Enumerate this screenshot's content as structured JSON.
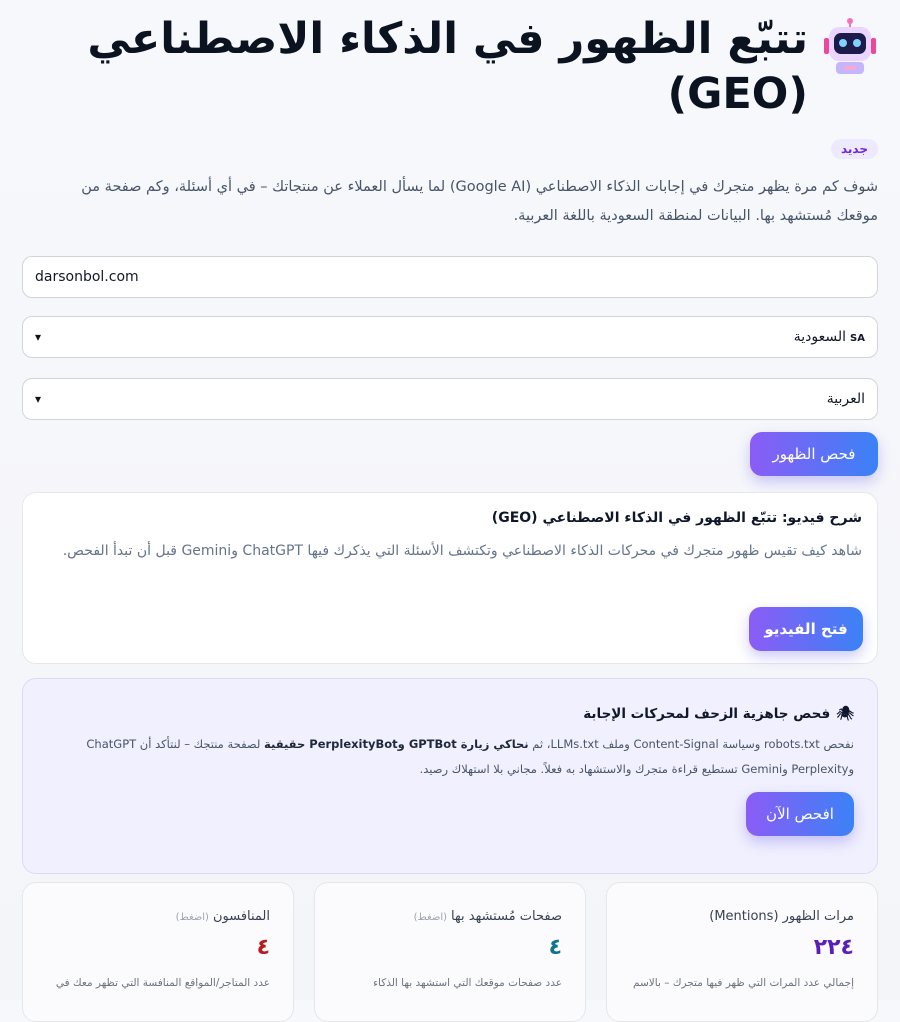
{
  "header": {
    "title": "تتبّع الظهور في الذكاء الاصطناعي (GEO)",
    "badge": "جديد",
    "intro": "شوف كم مرة يظهر متجرك في إجابات الذكاء الاصطناعي (Google AI) لما يسأل العملاء عن منتجاتك – في أي أسئلة، وكم صفحة من موقعك مُستشهد بها. البيانات لمنطقة السعودية باللغة العربية."
  },
  "form": {
    "domain_value": "darsonbol.com",
    "country_code": "SA",
    "country_value": "السعودية",
    "language_value": "العربية",
    "check_button": "فحص الظهور"
  },
  "video": {
    "title": "شرح فيديو: تتبّع الظهور في الذكاء الاصطناعي (GEO)",
    "description": "شاهد كيف تقيس ظهور متجرك في محركات الذكاء الاصطناعي وتكتشف الأسئلة التي يذكرك فيها ChatGPT وGemini قبل أن تبدأ الفحص.",
    "button": "فتح الفيديو"
  },
  "crawl": {
    "title": "فحص جاهزية الزحف لمحركات الإجابة",
    "desc_1": "نفحص robots.txt وسياسة Content-Signal وملف LLMs.txt، ثم ",
    "desc_bold_1": "نحاكي زيارة GPTBot وPerplexityBot حقيقية",
    "desc_2": " لصفحة منتجك – لنتأكد أن ChatGPT وPerplexity وGemini تستطيع قراءة متجرك والاستشهاد به فعلاً. مجاني بلا استهلاك رصيد.",
    "button": "افحص الآن"
  },
  "metrics": [
    {
      "label": "مرات الظهور (Mentions)",
      "hint": "",
      "value": "٢٢٤",
      "desc": "إجمالي عدد المرات التي ظهر فيها متجرك – بالاسم"
    },
    {
      "label": "صفحات مُستشهد بها",
      "hint": "(اضغط)",
      "value": "٤",
      "desc": "عدد صفحات موقعك التي استشهد بها الذكاء"
    },
    {
      "label": "المنافسون",
      "hint": "(اضغط)",
      "value": "٤",
      "desc": "عدد المتاجر/المواقع المنافسة التي تظهر معك في"
    }
  ],
  "colors": {
    "accent_start": "#8b5cf6",
    "accent_end": "#3b82f6",
    "mentions_value": "#5b21b6",
    "citations_value": "#0e7490",
    "competitors_value": "#b91c1c"
  },
  "icons": {
    "title_icon": "robot-icon",
    "crawl_icon": "spider-icon",
    "select_icon": "chevron-down-icon"
  }
}
